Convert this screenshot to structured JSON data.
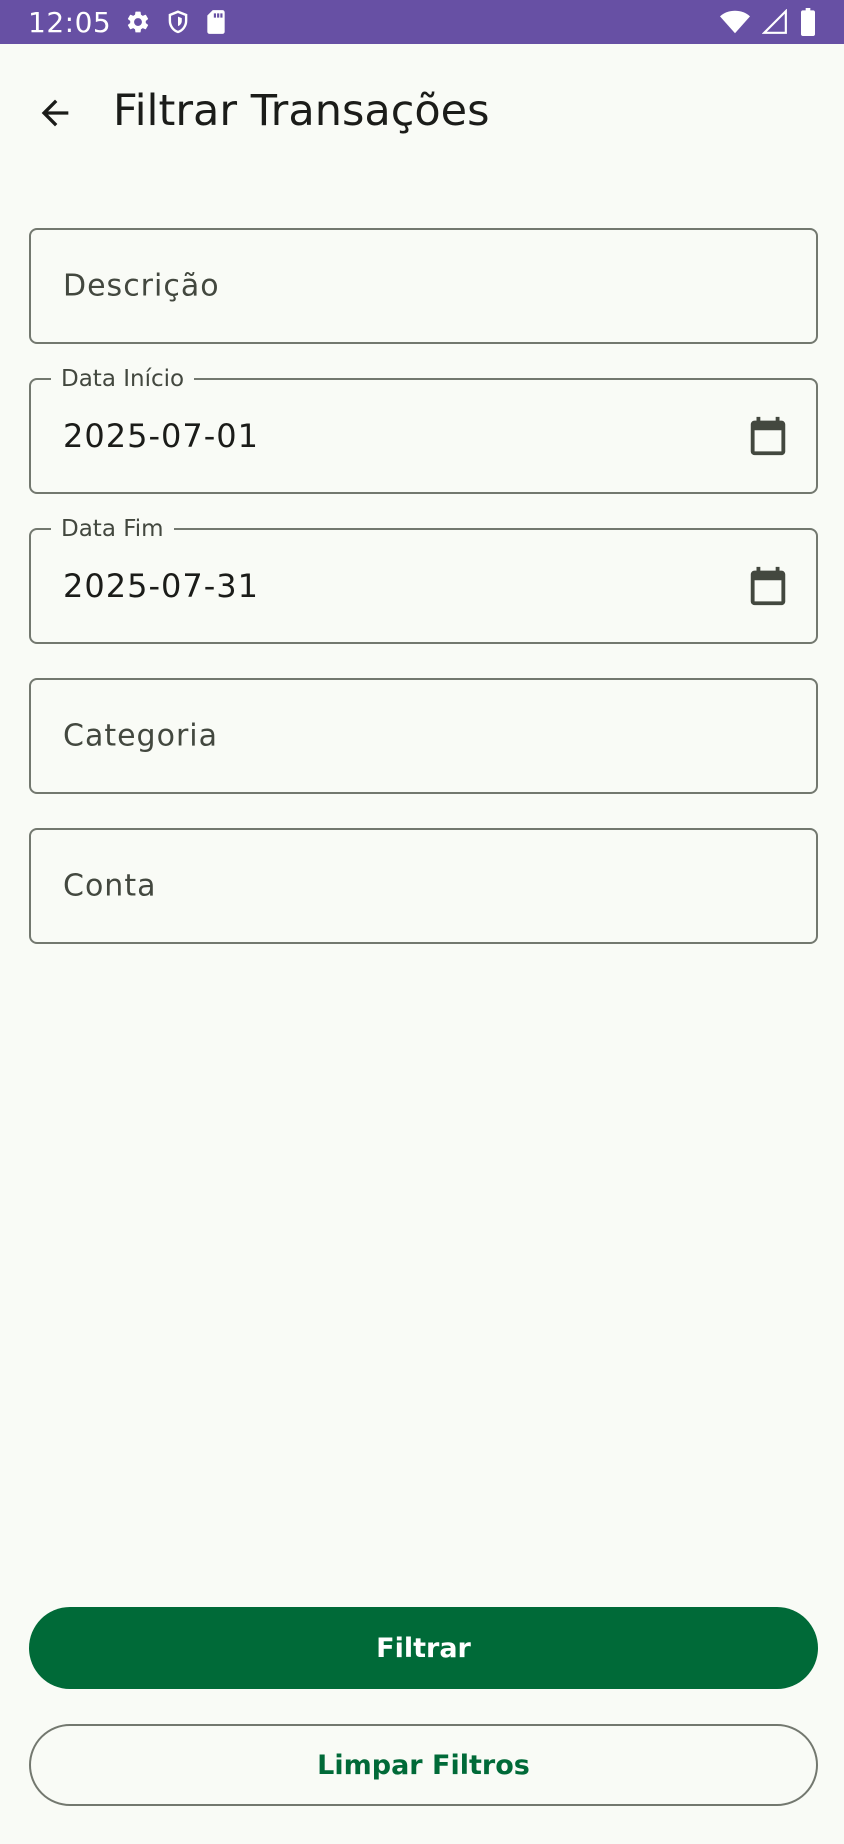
{
  "status_bar": {
    "time": "12:05",
    "left_icons": [
      "gear-icon",
      "shield-icon",
      "sd-card-icon"
    ],
    "right_icons": [
      "wifi-icon",
      "signal-icon",
      "battery-icon"
    ],
    "background_color": "#6750a4"
  },
  "app_bar": {
    "back_icon": "arrow-back-icon",
    "title": "Filtrar Transações"
  },
  "form": {
    "descricao": {
      "placeholder": "Descrição"
    },
    "data_inicio": {
      "label": "Data Início",
      "value": "2025-07-01",
      "icon": "calendar-icon"
    },
    "data_fim": {
      "label": "Data Fim",
      "value": "2025-07-31",
      "icon": "calendar-icon"
    },
    "categoria": {
      "placeholder": "Categoria"
    },
    "conta": {
      "placeholder": "Conta"
    }
  },
  "actions": {
    "filter_label": "Filtrar",
    "clear_label": "Limpar Filtros",
    "primary_color": "#006a38"
  }
}
